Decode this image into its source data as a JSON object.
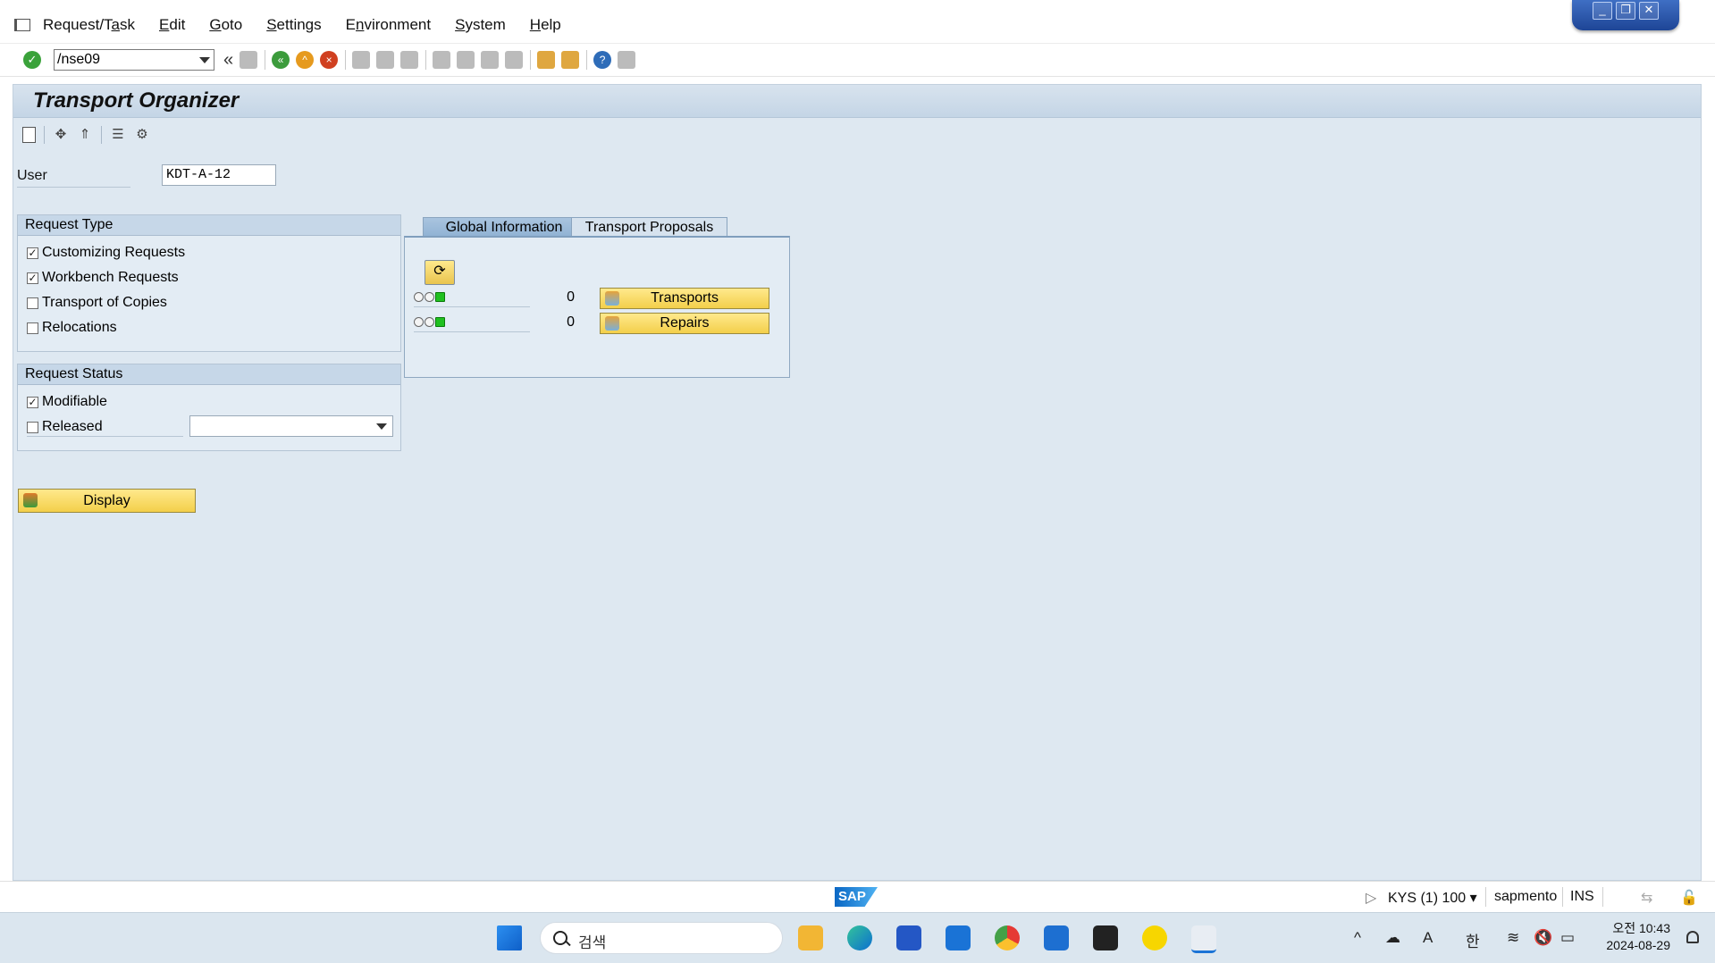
{
  "menu": {
    "items": [
      {
        "pre": "Request/T",
        "u": "a",
        "post": "sk"
      },
      {
        "pre": "",
        "u": "E",
        "post": "dit"
      },
      {
        "pre": "",
        "u": "G",
        "post": "oto"
      },
      {
        "pre": "",
        "u": "S",
        "post": "ettings"
      },
      {
        "pre": "E",
        "u": "n",
        "post": "vironment"
      },
      {
        "pre": "",
        "u": "S",
        "post": "ystem"
      },
      {
        "pre": "",
        "u": "H",
        "post": "elp"
      }
    ]
  },
  "toolbar": {
    "command_value": "/nse09",
    "back_glyph": "«"
  },
  "page": {
    "title": "Transport Organizer"
  },
  "user": {
    "label": "User",
    "value": "KDT-A-12"
  },
  "request_type": {
    "header": "Request Type",
    "items": [
      {
        "label": "Customizing Requests",
        "checked": true
      },
      {
        "label": "Workbench Requests",
        "checked": true
      },
      {
        "label": "Transport of Copies",
        "checked": false
      },
      {
        "label": "Relocations",
        "checked": false
      }
    ]
  },
  "request_status": {
    "header": "Request Status",
    "modifiable": {
      "label": "Modifiable",
      "checked": true
    },
    "released": {
      "label": "Released",
      "checked": false
    }
  },
  "tabs": {
    "global": "Global Information",
    "proposals": "Transport Proposals"
  },
  "global_info": {
    "transports_count": "0",
    "repairs_count": "0",
    "transports_label": "Transports",
    "repairs_label": "Repairs"
  },
  "display_button": "Display",
  "status_bar": {
    "system": "KYS (1) 100",
    "user": "sapmento",
    "mode": "INS",
    "logo": "SAP"
  },
  "taskbar": {
    "search_placeholder": "검색",
    "time": "오전 10:43",
    "date": "2024-08-29",
    "ime_a": "A",
    "ime_lang": "한"
  },
  "colors": {
    "main_bg": "#dee8f1",
    "button_yellow": "#f3cf4a",
    "group_header": "#c6d7e8",
    "title_bar": "#c4d5e6"
  }
}
